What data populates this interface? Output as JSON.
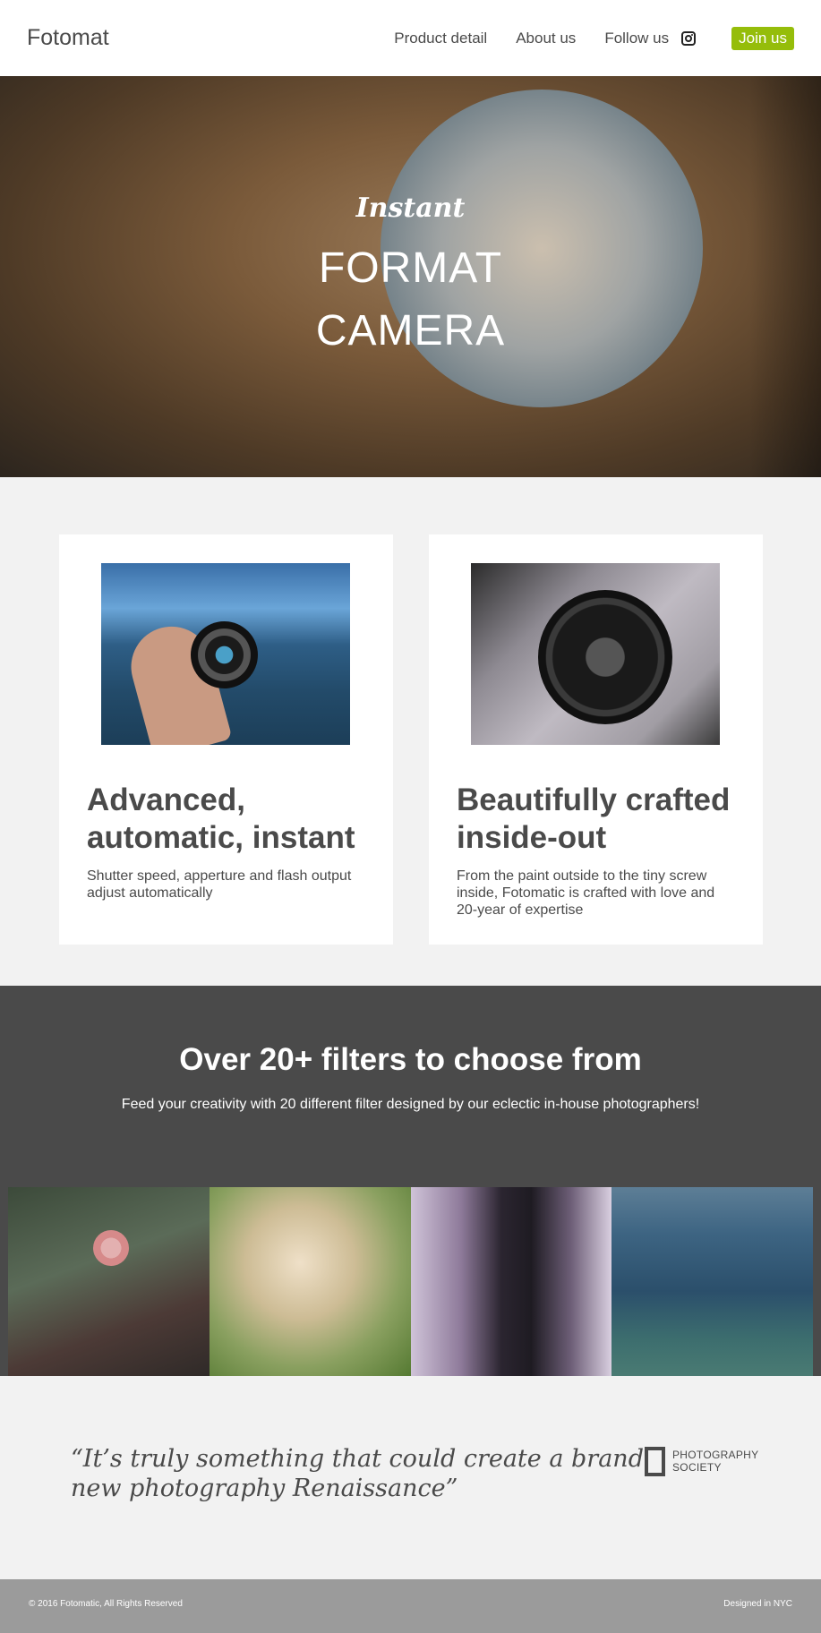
{
  "header": {
    "brand": "Fotomat",
    "nav": {
      "product_detail": "Product detail",
      "about_us": "About us",
      "follow_us": "Follow us",
      "join_us": "Join us"
    },
    "accent_color": "#95bd0a"
  },
  "hero": {
    "script": "Instant",
    "title": "FORMAT CAMERA"
  },
  "features": [
    {
      "title": "Advanced, automatic, instant",
      "text": "Shutter speed, apperture and flash output adjust automatically",
      "image": "lens-over-lake"
    },
    {
      "title": "Beautifully crafted inside-out",
      "text": "From the paint outside to the tiny screw inside, Fotomatic is crafted with love and 20-year of expertise",
      "image": "camera-lens-closeup"
    }
  ],
  "filters": {
    "title": "Over 20+ filters to choose from",
    "subtitle": "Feed your creativity with 20 different filter designed by our eclectic in-house photographers!",
    "images": [
      "person-holding-flower",
      "blossom-tree",
      "person-with-camera",
      "mountain-valley"
    ]
  },
  "testimonial": {
    "quote": "“It’s truly something that could create a brand new photography Renaissance”",
    "source": "PHOTOGRAPHY SOCIETY"
  },
  "footer": {
    "copyright": "© 2016 Fotomatic, All Rights Reserved",
    "designed": "Designed in NYC"
  }
}
